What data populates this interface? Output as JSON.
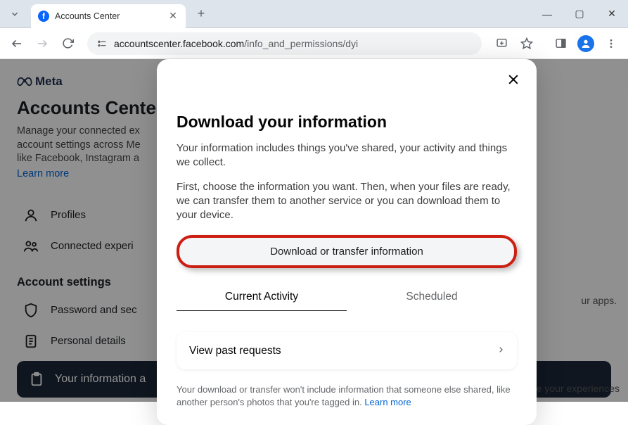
{
  "tab": {
    "title": "Accounts Center"
  },
  "url": {
    "domain": "accountscenter.facebook.com",
    "path": "/info_and_permissions/dyi"
  },
  "page": {
    "brand": "Meta",
    "title": "Accounts Center",
    "description_line1": "Manage your connected ex",
    "description_line2": "account settings across Me",
    "description_line3": "like Facebook, Instagram a",
    "learn_more": "Learn more",
    "sidebar": {
      "profiles": "Profiles",
      "connected": "Connected experi"
    },
    "section_label": "Account settings",
    "settings": {
      "password": "Password and sec",
      "personal": "Personal details",
      "info": "Your information a"
    },
    "rtext1": "ur apps.",
    "rtext2": "nce your experiences"
  },
  "modal": {
    "title": "Download your information",
    "p1": "Your information includes things you've shared, your activity and things we collect.",
    "p2": "First, choose the information you want. Then, when your files are ready, we can transfer them to another service or you can download them to your device.",
    "cta": "Download or transfer information",
    "tab_current": "Current Activity",
    "tab_scheduled": "Scheduled",
    "view_past": "View past requests",
    "footnote": "Your download or transfer won't include information that someone else shared, like another person's photos that you're tagged in. ",
    "footnote_link": "Learn more"
  }
}
